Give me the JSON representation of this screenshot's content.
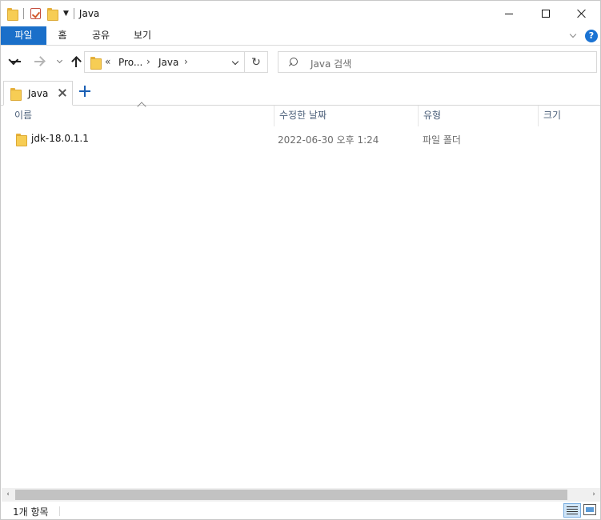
{
  "window": {
    "title": "Java",
    "controls": {
      "minimize": "",
      "maximize": "",
      "close": ""
    }
  },
  "ribbon": {
    "tabs": [
      "파일",
      "홈",
      "공유",
      "보기"
    ],
    "help_label": "?"
  },
  "navigation": {
    "breadcrumb_overflow": "«",
    "breadcrumb": [
      "Pro...",
      "Java"
    ],
    "separator": "›",
    "refresh_glyph": "↻"
  },
  "search": {
    "placeholder": "Java 검색"
  },
  "tabs": {
    "open": [
      {
        "label": "Java"
      }
    ],
    "new_tab": "+"
  },
  "columns": {
    "name": "이름",
    "date": "수정한 날짜",
    "type": "유형",
    "size": "크기"
  },
  "files": [
    {
      "name": "jdk-18.0.1.1",
      "date": "2022-06-30 오후 1:24",
      "type": "파일 폴더",
      "size": ""
    }
  ],
  "scrollbar": {
    "left_glyph": "‹",
    "right_glyph": "›"
  },
  "status": {
    "item_count": "1개 항목"
  },
  "colors": {
    "accent": "#1a6fc9",
    "folder": "#f7cd54",
    "header_text": "#4c607a"
  },
  "icons": [
    "folder-icon",
    "properties-icon",
    "back-icon",
    "forward-icon",
    "up-icon",
    "refresh-icon",
    "search-icon",
    "details-view-icon",
    "thumbnail-view-icon"
  ]
}
